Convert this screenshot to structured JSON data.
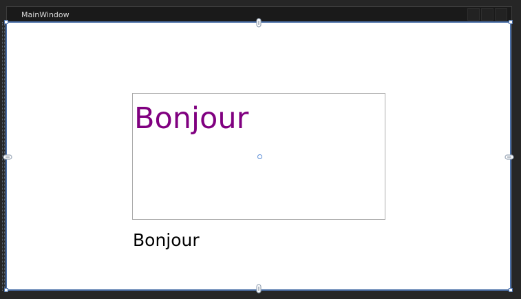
{
  "window": {
    "title": "MainWindow"
  },
  "textbox": {
    "text": "Bonjour",
    "text_color": "#800080"
  },
  "label": {
    "text": "Bonjour",
    "text_color": "#000000"
  },
  "colors": {
    "selection": "#4a6fa8",
    "client_background": "#ffffff",
    "designer_background": "#262626"
  },
  "icons": {
    "anchor": "anchor-icon",
    "center": "center-point-icon"
  }
}
